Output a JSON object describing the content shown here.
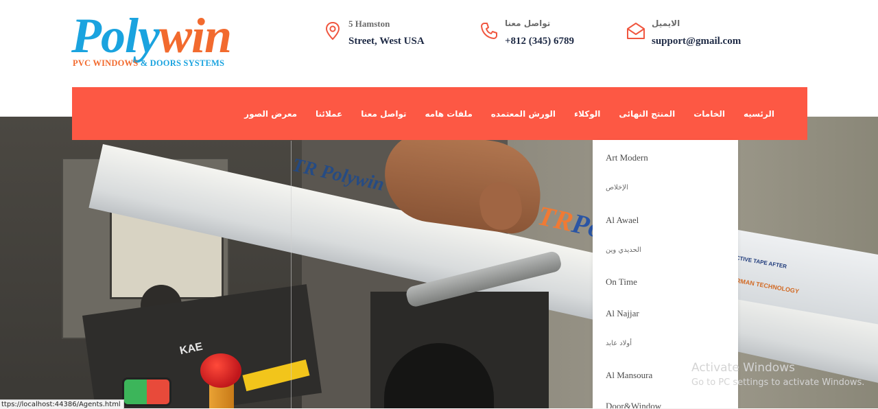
{
  "logo": {
    "word_part1": "Poly",
    "word_part2": "win",
    "tagline_part1": "PVC WINDOWS",
    "tagline_part2": "& DOORS SYSTEMS",
    "colors": {
      "blue": "#1aa3df",
      "orange": "#f26a2e"
    }
  },
  "contact": [
    {
      "icon": "location-pin-icon",
      "label": "5 Hamston",
      "value": "Street, West USA"
    },
    {
      "icon": "phone-icon",
      "label": "تواصل معنا",
      "value": "+812 (345) 6789"
    },
    {
      "icon": "envelope-icon",
      "label": "الايميل",
      "value": "support@gmail.com"
    }
  ],
  "nav": {
    "background": "#fd5844",
    "items": [
      "الرئسيه",
      "الخامات",
      "المنتج النهائى",
      "الوكلاء",
      "الورش المعتمده",
      "ملفات هامه",
      "تواصل معنا",
      "عملائنا",
      "معرض الصور"
    ]
  },
  "dropdown": {
    "items": [
      "Art Modern",
      "الإخلاص",
      "Al Awael",
      "الحديدي وين",
      "On Time",
      "Al Najjar",
      "أولاد عابد",
      "Al Mansoura",
      "Door&Window"
    ]
  },
  "hero": {
    "profile_brand": "TR Polywin",
    "profile_brand_tr": "TR",
    "profile_brand_rest": "Po",
    "tape_text": "CTIVE TAPE AFTER",
    "tech_text": "ERMAN TECHNOLOGY",
    "machine_brand": "KAE"
  },
  "watermark": {
    "title": "Activate Windows",
    "subtitle": "Go to PC settings to activate Windows."
  },
  "status_url": "ttps://localhost:44386/Agents.html"
}
